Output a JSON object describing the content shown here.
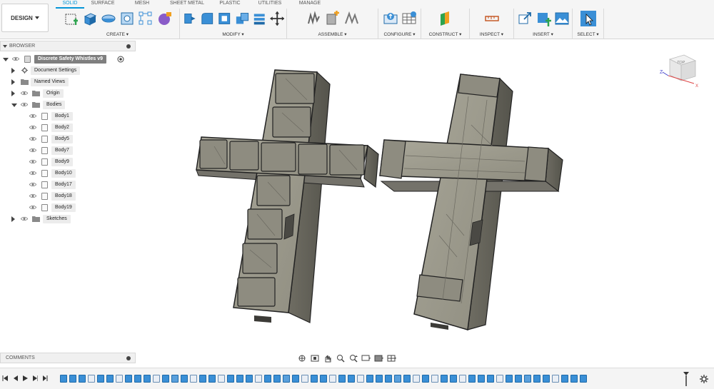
{
  "workspace": {
    "label": "DESIGN"
  },
  "tabs": [
    "SOLID",
    "SURFACE",
    "MESH",
    "SHEET METAL",
    "PLASTIC",
    "UTILITIES",
    "MANAGE"
  ],
  "active_tab": "SOLID",
  "groups": [
    {
      "label": "CREATE",
      "icons": [
        "new-sketch-icon",
        "extrude-icon",
        "revolve-surface-icon",
        "hole-icon",
        "pattern-icon",
        "form-icon"
      ]
    },
    {
      "label": "MODIFY",
      "icons": [
        "press-pull-icon",
        "fillet-icon",
        "shell-icon",
        "combine-icon",
        "stack-icon",
        "move-icon"
      ]
    },
    {
      "label": "ASSEMBLE",
      "icons": [
        "new-component-icon",
        "joint-icon",
        "as-built-joint-icon"
      ]
    },
    {
      "label": "CONFIGURE",
      "icons": [
        "configure-icon",
        "table-icon"
      ]
    },
    {
      "label": "CONSTRUCT",
      "icons": [
        "plane-icon"
      ]
    },
    {
      "label": "INSPECT",
      "icons": [
        "measure-icon"
      ]
    },
    {
      "label": "INSERT",
      "icons": [
        "insert-link-icon",
        "insert-plus-icon",
        "insert-image-icon"
      ]
    },
    {
      "label": "SELECT",
      "icons": [
        "select-arrow-icon"
      ]
    }
  ],
  "browser": {
    "title": "BROWSER",
    "root": "Discrete Safety Whistles v9",
    "items": [
      {
        "label": "Document Settings",
        "kind": "settings",
        "level": 1
      },
      {
        "label": "Named Views",
        "kind": "folder",
        "level": 1
      },
      {
        "label": "Origin",
        "kind": "folder",
        "level": 1
      },
      {
        "label": "Bodies",
        "kind": "folder",
        "level": 1,
        "expanded": true
      }
    ],
    "bodies": [
      "Body1",
      "Body2",
      "Body5",
      "Body7",
      "Body9",
      "Body10",
      "Body17",
      "Body18",
      "Body19"
    ],
    "sketches_label": "Sketches"
  },
  "comments": {
    "title": "COMMENTS"
  },
  "viewcube": {
    "face_label": "TOP",
    "axis_z": "Z",
    "axis_x": "X"
  },
  "colors": {
    "accent": "#0696d7",
    "model_body": "#9b998c",
    "model_edge": "#2a2a2a",
    "toolbar_bg": "#f5f5f5"
  },
  "timeline": {
    "count": 57,
    "kinds": [
      "extrude",
      "extrude",
      "extrude",
      "sketch",
      "extrude",
      "extrude",
      "sketch",
      "extrude",
      "extrude",
      "extrude",
      "sketch",
      "extrude",
      "combine",
      "extrude",
      "sketch",
      "extrude",
      "extrude",
      "sketch",
      "extrude",
      "extrude",
      "extrude",
      "sketch",
      "extrude",
      "extrude",
      "combine",
      "extrude",
      "sketch",
      "extrude",
      "extrude",
      "sketch",
      "extrude",
      "extrude",
      "sketch",
      "extrude",
      "extrude",
      "extrude",
      "combine",
      "extrude",
      "sketch",
      "extrude",
      "sketch",
      "extrude",
      "extrude",
      "sketch",
      "extrude",
      "extrude",
      "extrude",
      "sketch",
      "extrude",
      "extrude",
      "combine",
      "extrude",
      "extrude",
      "sketch",
      "extrude",
      "extrude",
      "extrude"
    ]
  }
}
